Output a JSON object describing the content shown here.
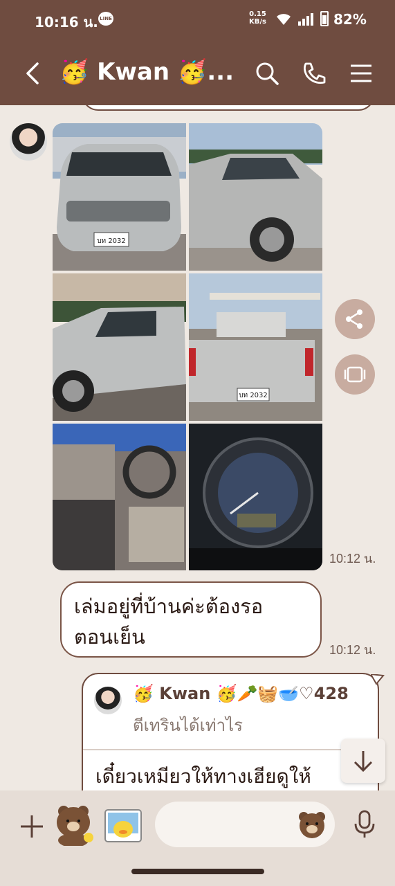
{
  "status_bar": {
    "time": "10:16 น.",
    "line_badge": "LINE",
    "net_speed": "0.15",
    "net_unit": "KB/s",
    "battery": "82%"
  },
  "header": {
    "title": "🥳 Kwan 🥳..."
  },
  "chat": {
    "photo_time": "10:12 น.",
    "text_message": "เล่มอยู่ที่บ้านค่ะต้องรอตอนเย็น",
    "text_line1": "เล่มอยู่ที่บ้านค่ะต้องรอ",
    "text_line2": "ตอนเย็น",
    "text_time": "10:12 น.",
    "reply": {
      "quoted_name": "🥳 Kwan 🥳🥕🧺🥣♡428",
      "quoted_text": "ตีเทรินได้เท่าไร",
      "body": "เดี๋ยวเหมียวให้ทางเฮียดูให้"
    }
  },
  "photos": [
    {
      "label": "front",
      "plate": "บท 2032"
    },
    {
      "label": "side-right"
    },
    {
      "label": "side-left"
    },
    {
      "label": "rear",
      "plate": "บท 2032"
    },
    {
      "label": "interior"
    },
    {
      "label": "dashboard"
    }
  ],
  "icons": {
    "back": "chevron-left-icon",
    "search": "search-icon",
    "call": "phone-icon",
    "menu": "menu-icon",
    "share": "share-icon",
    "save": "album-icon",
    "plus": "plus-icon",
    "mic": "mic-icon",
    "scroll": "arrow-down-icon"
  },
  "colors": {
    "header_bg": "#6f4c40",
    "chat_bg": "#efe9e3",
    "bubble_border": "#7a5446",
    "accent": "#c8aca0"
  }
}
